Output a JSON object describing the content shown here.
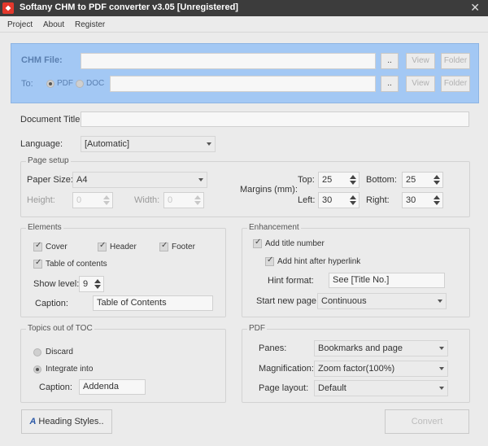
{
  "window": {
    "title": "Softany CHM to PDF converter v3.05 [Unregistered]",
    "close_glyph": "✕"
  },
  "menu": [
    "Project",
    "About",
    "Register"
  ],
  "source": {
    "chm_label": "CHM File:",
    "chm_value": "",
    "to_label": "To:",
    "format_pdf": "PDF",
    "format_doc": "DOC",
    "to_value": "",
    "browse_label": "..",
    "view_label": "View",
    "folder_label": "Folder"
  },
  "document": {
    "title_label": "Document Title:",
    "title_value": "",
    "language_label": "Language:",
    "language_value": "[Automatic]"
  },
  "page_setup": {
    "legend": "Page setup",
    "paper_size_label": "Paper Size:",
    "paper_size_value": "A4",
    "height_label": "Height:",
    "height_value": "0",
    "width_label": "Width:",
    "width_value": "0",
    "margins_label": "Margins (mm):",
    "top_label": "Top:",
    "top_value": "25",
    "bottom_label": "Bottom:",
    "bottom_value": "25",
    "left_label": "Left:",
    "left_value": "30",
    "right_label": "Right:",
    "right_value": "30"
  },
  "elements": {
    "legend": "Elements",
    "cover": "Cover",
    "header": "Header",
    "footer": "Footer",
    "toc": "Table of contents",
    "show_level_label": "Show level:",
    "show_level_value": "9",
    "caption_label": "Caption:",
    "caption_value": "Table of Contents"
  },
  "enhancement": {
    "legend": "Enhancement",
    "add_title_number": "Add title number",
    "add_hint": "Add hint after hyperlink",
    "hint_format_label": "Hint format:",
    "hint_format_value": "See [Title No.]",
    "start_new_page_label": "Start new page:",
    "start_new_page_value": "Continuous"
  },
  "topics": {
    "legend": "Topics out of TOC",
    "discard": "Discard",
    "integrate": "Integrate into",
    "caption_label": "Caption:",
    "caption_value": "Addenda"
  },
  "pdf": {
    "legend": "PDF",
    "panes_label": "Panes:",
    "panes_value": "Bookmarks and page",
    "magnification_label": "Magnification:",
    "magnification_value": "Zoom factor(100%)",
    "page_layout_label": "Page layout:",
    "page_layout_value": "Default"
  },
  "footer": {
    "heading_styles_label": "Heading Styles..",
    "convert_label": "Convert"
  }
}
